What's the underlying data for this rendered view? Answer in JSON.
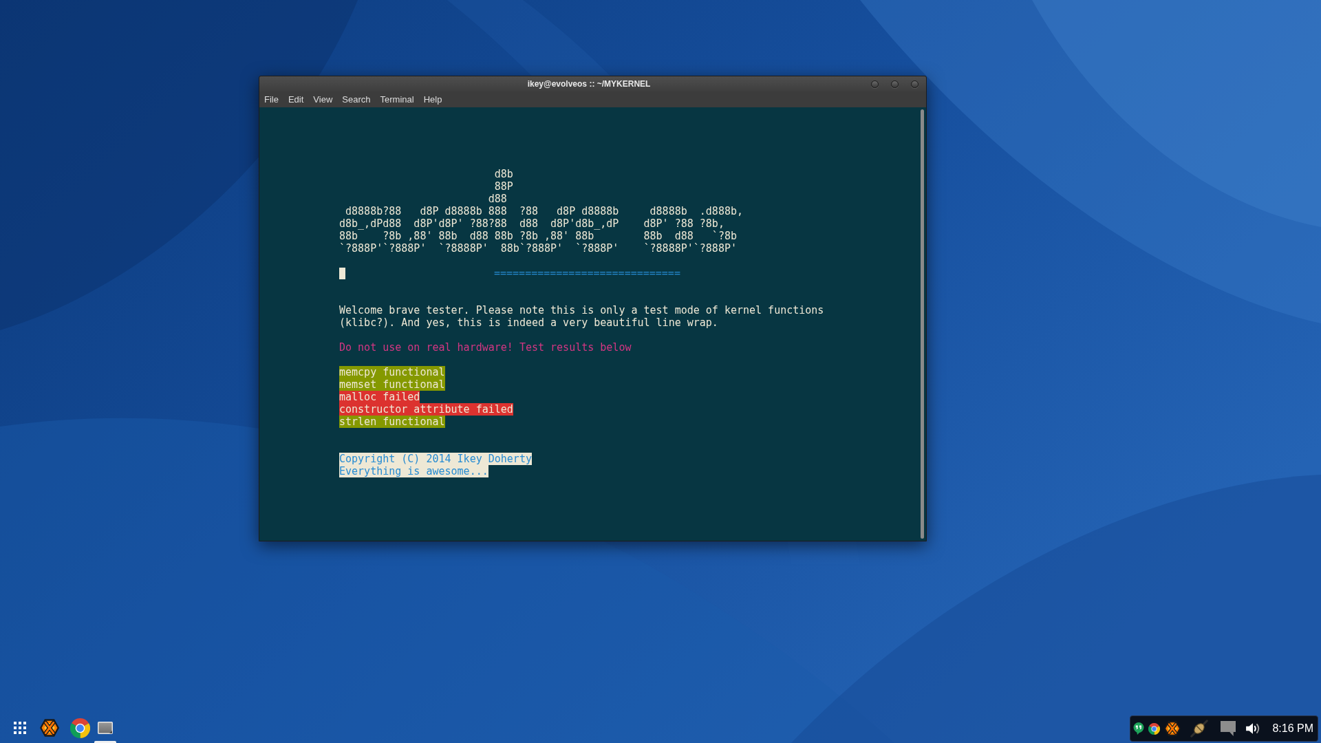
{
  "window": {
    "title": "ikey@evolveos :: ~/MYKERNEL"
  },
  "menu_bar": [
    "File",
    "Edit",
    "View",
    "Search",
    "Terminal",
    "Help"
  ],
  "terminal": {
    "banner": [
      "                         d8b",
      "                         88P",
      "                        d88",
      " d8888b?88   d8P d8888b 888  ?88   d8P d8888b     d8888b  .d888b,",
      "d8b_,dPd88  d8P'd8P' ?88?88  d88  d8P'd8b_,dP    d8P' ?88 ?8b,",
      "88b    ?8b ,88' 88b  d88 88b ?8b ,88' 88b        88b  d88   `?8b",
      "`?888P'`?888P'  `?8888P'  88b`?888P'  `?888P'    `?8888P'`?888P'"
    ],
    "rule": "==============================",
    "message": "Welcome brave tester. Please note this is only a test mode of kernel functions (klibc?). And yes, this is indeed a very beautiful line wrap.",
    "warning": "Do not use on real hardware! Test results below",
    "results": [
      {
        "text": "memcpy functional",
        "passed": true
      },
      {
        "text": "memset functional",
        "passed": true
      },
      {
        "text": "malloc failed",
        "passed": false
      },
      {
        "text": "constructor attribute failed",
        "passed": false
      },
      {
        "text": "strlen functional",
        "passed": true
      }
    ],
    "footer": [
      "Copyright (C) 2014 Ikey Doherty",
      "Everything is awesome..."
    ]
  },
  "taskbar": {
    "launchers": [
      {
        "kind": "app-grid",
        "running": false
      },
      {
        "kind": "hexagon",
        "running": false
      },
      {
        "kind": "browser",
        "running": false
      },
      {
        "kind": "terminal",
        "running": true
      }
    ],
    "tray": [
      {
        "kind": "chat"
      },
      {
        "kind": "browser"
      },
      {
        "kind": "hexagon"
      },
      {
        "kind": "plug"
      },
      {
        "kind": "message"
      },
      {
        "kind": "volume"
      }
    ],
    "clock": "8:16 PM"
  }
}
